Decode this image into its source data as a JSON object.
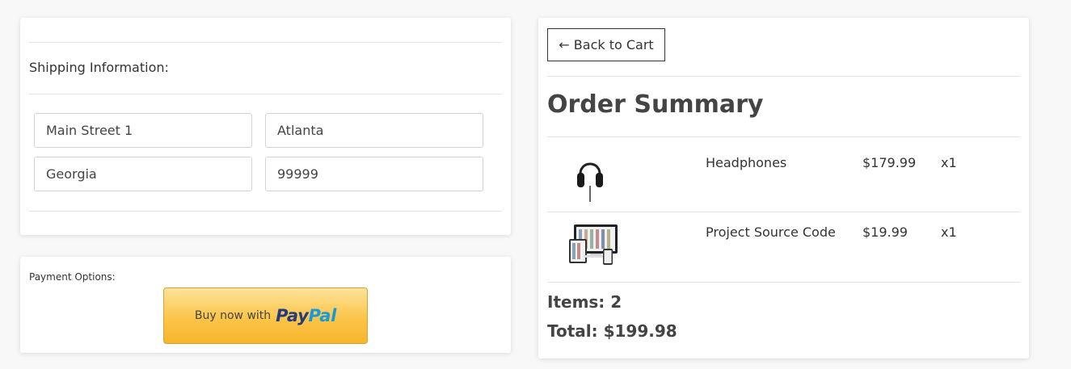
{
  "shipping": {
    "title": "Shipping Information:",
    "address": "Main Street 1",
    "city": "Atlanta",
    "state": "Georgia",
    "zip": "99999"
  },
  "payment": {
    "title": "Payment Options:",
    "paypal_prefix": "Buy now with",
    "paypal_brand_1": "Pay",
    "paypal_brand_2": "Pal"
  },
  "order": {
    "back_label": "← Back to Cart",
    "title": "Order Summary",
    "items": [
      {
        "name": "Headphones",
        "price": "$179.99",
        "qty": "x1",
        "image": "headphones-image"
      },
      {
        "name": "Project Source Code",
        "price": "$19.99",
        "qty": "x1",
        "image": "devices-image"
      }
    ],
    "items_label": "Items: 2",
    "total_label": "Total: $199.98"
  }
}
